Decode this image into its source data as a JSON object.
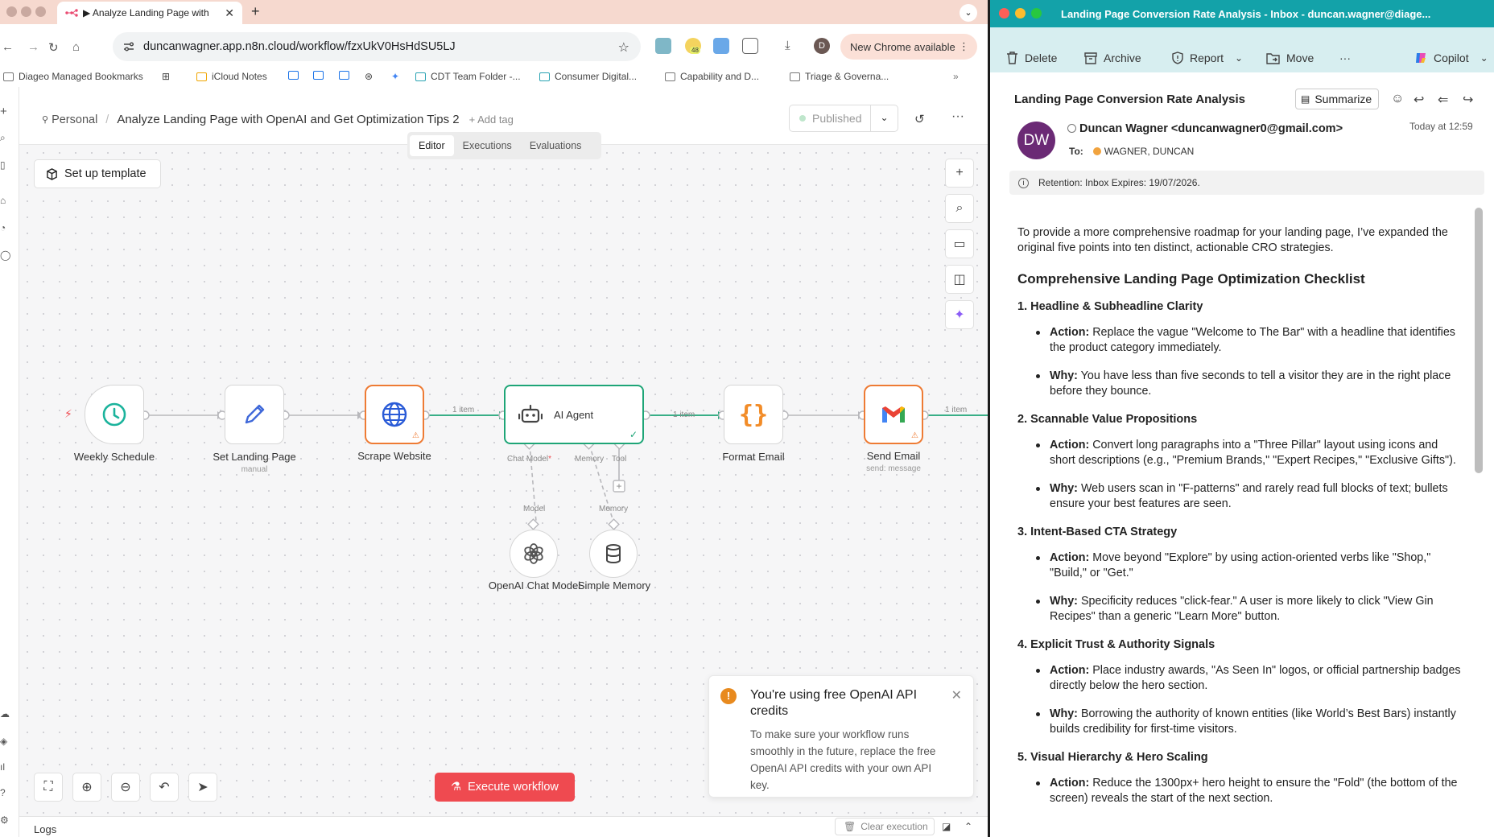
{
  "browser": {
    "tab_title": "▶ Analyze Landing Page with",
    "url": "duncanwagner.app.n8n.cloud/workflow/fzxUkV0HsHdSU5LJ",
    "extension_badge": "48",
    "profile_letter": "D",
    "new_chrome_label": "New Chrome available",
    "bookmarks": [
      "Diageo Managed Bookmarks",
      "iCloud Notes",
      "CDT Team Folder -...",
      "Consumer Digital...",
      "Capability and D...",
      "Triage & Governa..."
    ]
  },
  "n8n": {
    "breadcrumb_personal": "Personal",
    "workflow_name": "Analyze Landing Page with OpenAI and Get Optimization Tips 2",
    "add_tag": "+ Add tag",
    "published_label": "Published",
    "tabs": [
      "Editor",
      "Executions",
      "Evaluations"
    ],
    "setup_template": "Set up template",
    "nodes": {
      "weekly_schedule": "Weekly Schedule",
      "set_landing_page": "Set Landing Page",
      "set_landing_page_sub": "manual",
      "scrape_website": "Scrape Website",
      "ai_agent": "AI Agent",
      "format_email": "Format Email",
      "send_email": "Send Email",
      "send_email_sub": "send: message",
      "openai_model": "OpenAI Chat Model",
      "simple_memory": "Simple Memory"
    },
    "edge_labels": {
      "item1": "1 item",
      "item2": "1 item",
      "item3": "1 item"
    },
    "agent_ports": {
      "chat_model": "Chat Model",
      "memory": "Memory",
      "tool": "Tool"
    },
    "sub_ports": {
      "model": "Model",
      "memory": "Memory"
    },
    "toast": {
      "title": "You're using free OpenAI API credits",
      "body": "To make sure your workflow runs smoothly in the future, replace the free OpenAI API credits with your own API key."
    },
    "execute_label": "Execute workflow",
    "logs_label": "Logs",
    "clear_execution": "Clear execution"
  },
  "outlook": {
    "window_title": "Landing Page Conversion Rate Analysis - Inbox - duncan.wagner@diage...",
    "toolbar": {
      "delete": "Delete",
      "archive": "Archive",
      "report": "Report",
      "move": "Move",
      "more": "···",
      "copilot": "Copilot"
    },
    "subject": "Landing Page Conversion Rate Analysis",
    "summarize": "Summarize",
    "avatar_initials": "DW",
    "sender": "Duncan Wagner <duncanwagner0@gmail.com>",
    "time": "Today at 12:59",
    "to_label": "To:",
    "to_name": "WAGNER, DUNCAN",
    "retention": "Retention: Inbox Expires: 19/07/2026.",
    "body": {
      "intro": "To provide a more comprehensive roadmap for your landing page, I’ve expanded the original five points into ten distinct, actionable CRO strategies.",
      "heading": "Comprehensive Landing Page Optimization Checklist",
      "sections": [
        {
          "title": "1. Headline & Subheadline Clarity",
          "action": "Replace the vague \"Welcome to The Bar\" with a headline that identifies the product category immediately.",
          "why": "You have less than five seconds to tell a visitor they are in the right place before they bounce."
        },
        {
          "title": "2. Scannable Value Propositions",
          "action": "Convert long paragraphs into a \"Three Pillar\" layout using icons and short descriptions (e.g., \"Premium Brands,\" \"Expert Recipes,\" \"Exclusive Gifts\").",
          "why": "Web users scan in \"F-patterns\" and rarely read full blocks of text; bullets ensure your best features are seen."
        },
        {
          "title": "3. Intent-Based CTA Strategy",
          "action": "Move beyond \"Explore\" by using action-oriented verbs like \"Shop,\" \"Build,\" or \"Get.\"",
          "why": "Specificity reduces \"click-fear.\" A user is more likely to click \"View Gin Recipes\" than a generic \"Learn More\" button."
        },
        {
          "title": "4. Explicit Trust & Authority Signals",
          "action": "Place industry awards, \"As Seen In\" logos, or official partnership badges directly below the hero section.",
          "why": "Borrowing the authority of known entities (like World’s Best Bars) instantly builds credibility for first-time visitors."
        },
        {
          "title": "5. Visual Hierarchy & Hero Scaling",
          "action": "Reduce the 1300px+ hero height to ensure the \"Fold\" (the bottom of the screen) reveals the start of the next section.",
          "why": ""
        }
      ],
      "action_label": "Action:",
      "why_label": "Why:"
    }
  }
}
